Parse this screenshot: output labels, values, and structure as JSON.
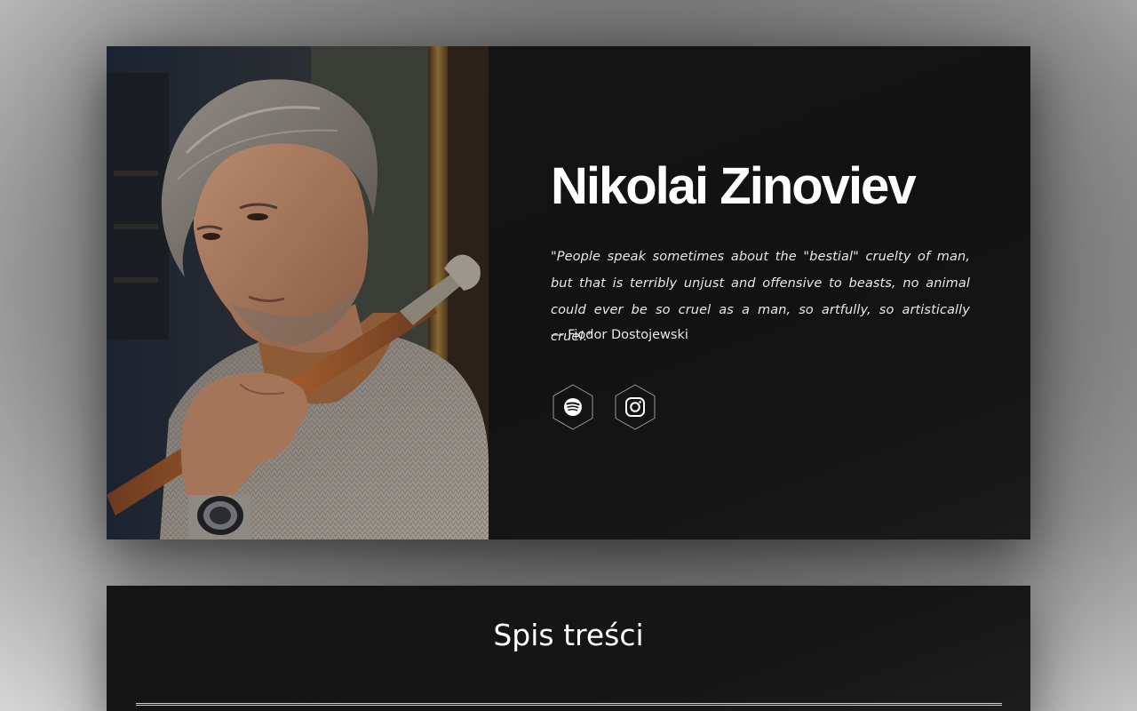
{
  "hero": {
    "name": "Nikolai Zinoviev",
    "quote": "\"People speak sometimes about the \"bestial\" cruelty of man, but that is terribly unjust and offensive to beasts, no animal could ever be so cruel as a man, so artfully, so artistically cruel.\"",
    "author": "— Fiodor Dostojewski",
    "socials": [
      {
        "icon": "spotify-icon"
      },
      {
        "icon": "instagram-icon"
      }
    ]
  },
  "toc": {
    "title": "Spis treści"
  },
  "colors": {
    "card_background": "#141414",
    "text": "#ffffff",
    "quote_text": "#e8e8e8",
    "icon_stroke": "#bdbdbd"
  }
}
